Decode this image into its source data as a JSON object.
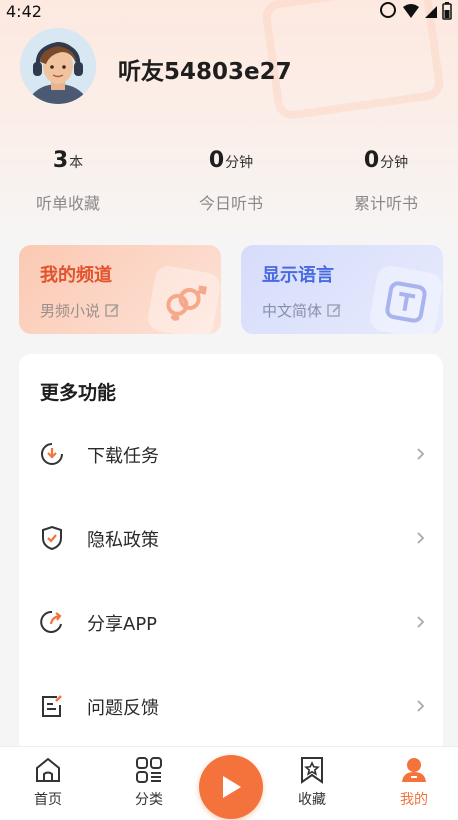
{
  "status_bar": {
    "time": "4:42"
  },
  "profile": {
    "username": "听友54803e27"
  },
  "stats": [
    {
      "value": "3",
      "unit": "本",
      "label": "听单收藏"
    },
    {
      "value": "0",
      "unit": "分钟",
      "label": "今日听书"
    },
    {
      "value": "0",
      "unit": "分钟",
      "label": "累计听书"
    }
  ],
  "cards": {
    "channel": {
      "title": "我的频道",
      "subtitle": "男频小说"
    },
    "language": {
      "title": "显示语言",
      "subtitle": "中文简体"
    }
  },
  "more": {
    "title": "更多功能",
    "items": [
      {
        "label": "下载任务",
        "icon": "download-task-icon"
      },
      {
        "label": "隐私政策",
        "icon": "privacy-shield-icon"
      },
      {
        "label": "分享APP",
        "icon": "share-icon"
      },
      {
        "label": "问题反馈",
        "icon": "feedback-icon"
      }
    ]
  },
  "nav": {
    "home": "首页",
    "category": "分类",
    "favorites": "收藏",
    "mine": "我的"
  },
  "colors": {
    "accent": "#f4733c",
    "channel_title": "#e2532c",
    "language_title": "#4a6ae0"
  }
}
